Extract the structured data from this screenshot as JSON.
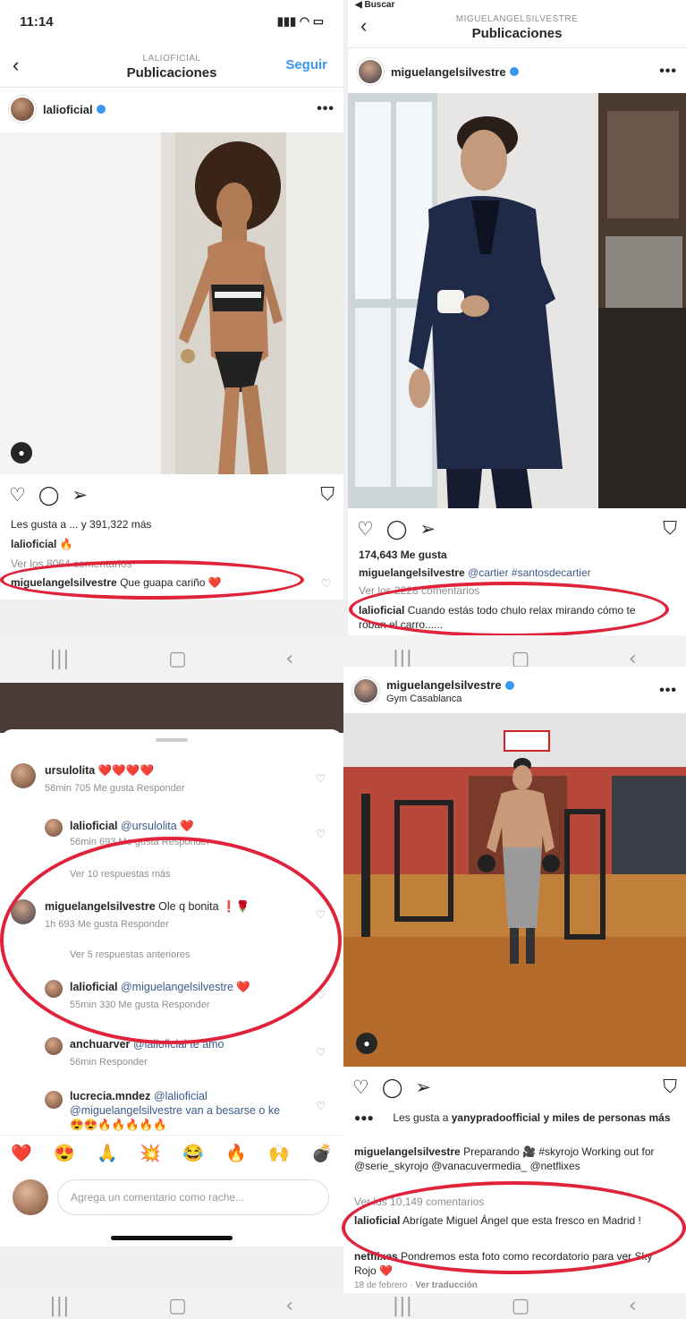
{
  "panel1": {
    "time": "11:14",
    "header_small": "LALIOFICIAL",
    "header_big": "Publicaciones",
    "follow": "Seguir",
    "username": "lalioficial",
    "likes": "Les gusta a ... y 391,322 más",
    "caption_user": "lalioficial",
    "caption_text": "🔥",
    "view_comments": "Ver los 8064 comentarios",
    "comment_user": "miguelangelsilvestre",
    "comment_text": "Que guapa cariño ❤️"
  },
  "panel2": {
    "status_back": "◀ Buscar",
    "header_small": "MIGUELANGELSILVESTRE",
    "header_big": "Publicaciones",
    "username": "miguelangelsilvestre",
    "likes": "174,643 Me gusta",
    "caption_user": "miguelangelsilvestre",
    "caption_text": "@cartier #santosdecartier",
    "view_comments": "Ver los 2228 comentarios",
    "comment_user": "lalioficial",
    "comment_text": "Cuando estás todo chulo relax mirando cómo te roban el carro......"
  },
  "panel3": {
    "c1_user": "ursulolita",
    "c1_text": "❤️❤️❤️❤️",
    "c1_meta": "58min   705 Me gusta   Responder",
    "c2_user": "lalioficial",
    "c2_text": "@ursulolita ❤️",
    "c2_meta": "56min   693 Me gusta   Responder",
    "more1": "Ver 10 respuestas más",
    "c3_user": "miguelangelsilvestre",
    "c3_text": "Ole q bonita ❗🌹",
    "c3_meta": "1h   693 Me gusta   Responder",
    "more2": "Ver 5 respuestas anteriores",
    "c4_user": "lalioficial",
    "c4_text": "@miguelangelsilvestre ❤️",
    "c4_meta": "55min   330 Me gusta   Responder",
    "c5_user": "anchuarver",
    "c5_text": "@lalioficial te amo",
    "c5_meta": "56min   Responder",
    "c6_user": "lucrecia.mndez",
    "c6_text": "@lalioficial @miguelangelsilvestre van a besarse o ke 😍😍🔥🔥🔥🔥🔥",
    "emojis": [
      "❤️",
      "😍",
      "🙏",
      "💥",
      "😂",
      "🔥",
      "🙌",
      "💣"
    ],
    "input_placeholder": "Agrega un comentario como rache..."
  },
  "panel4": {
    "username": "miguelangelsilvestre",
    "location": "Gym Casablanca",
    "likes_prefix": "Les gusta a",
    "likes_user": "yanypradoofficial",
    "likes_suffix": "y miles de personas más",
    "caption_user": "miguelangelsilvestre",
    "caption_text": "Preparando 🎥 #skyrojo Working out for @serie_skyrojo @vanacuvermedia_ @netflixes",
    "view_comments": "Ver los 10,149 comentarios",
    "comment_user": "lalioficial",
    "comment_text": "Abrígate Miguel Ángel que esta fresco en Madrid !",
    "c2_user": "netflixes",
    "c2_text": "Pondremos esta foto como recordatorio para ver Sky Rojo ❤️",
    "date": "18 de febrero",
    "translate": "Ver traducción"
  },
  "nav": {
    "menu": "|||",
    "home": "▢",
    "back": "‹"
  },
  "colors": {
    "highlight": "#e0233b",
    "link": "#3897f0"
  }
}
